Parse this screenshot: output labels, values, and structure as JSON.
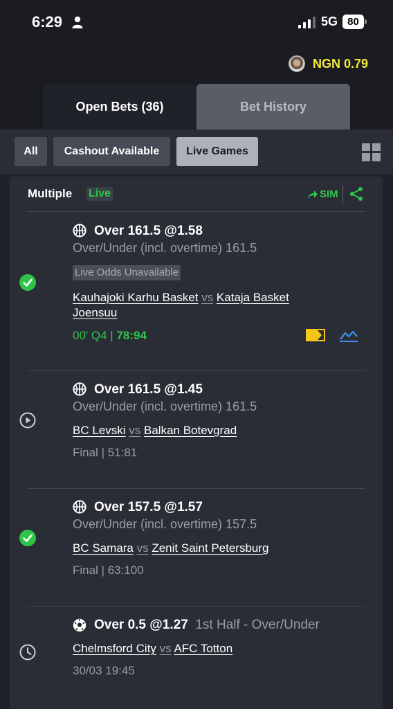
{
  "status_bar": {
    "time": "6:29",
    "network": "5G",
    "battery": "80"
  },
  "balance": {
    "text": "NGN 0.79"
  },
  "tabs": [
    {
      "label": "Open Bets (36)",
      "active": true
    },
    {
      "label": "Bet History",
      "active": false
    }
  ],
  "filters": [
    {
      "label": "All",
      "active": false
    },
    {
      "label": "Cashout Available",
      "active": false
    },
    {
      "label": "Live Games",
      "active": true
    }
  ],
  "colors": {
    "accent_green": "#2ec44a",
    "balance_yellow": "#f5e93a",
    "background": "#1f2229",
    "card": "#2a2d35"
  },
  "bet": {
    "title": "Multiple",
    "live_badge": "Live",
    "sim_label": "SIM",
    "selections": [
      {
        "status_icon": "check-circle-icon",
        "sport_icon": "basketball-icon",
        "title": "Over 161.5 @1.58",
        "market": "Over/Under (incl. overtime) 161.5",
        "notice": "Live Odds Unavailable",
        "home": "Kauhajoki Karhu Basket",
        "vs": "vs",
        "away": "Kataja Basket Joensuu",
        "time": "00' Q4 | ",
        "score": "78:94"
      },
      {
        "status_icon": "play-circle-icon",
        "sport_icon": "basketball-icon",
        "title": "Over 161.5 @1.45",
        "market": "Over/Under (incl. overtime) 161.5",
        "home": "BC Levski",
        "vs": "vs",
        "away": "Balkan Botevgrad",
        "result": "Final | 51:81"
      },
      {
        "status_icon": "check-circle-icon",
        "sport_icon": "basketball-icon",
        "title": "Over 157.5 @1.57",
        "market": "Over/Under (incl. overtime) 157.5",
        "home": "BC Samara",
        "vs": "vs",
        "away": "Zenit Saint Petersburg",
        "result": "Final | 63:100"
      },
      {
        "status_icon": "clock-icon",
        "sport_icon": "soccer-ball-icon",
        "title": "Over 0.5 @1.27",
        "extra": "1st Half  -  Over/Under",
        "home": "Chelmsford City",
        "vs": "vs",
        "away": "AFC Totton",
        "result": "30/03 19:45"
      }
    ]
  }
}
